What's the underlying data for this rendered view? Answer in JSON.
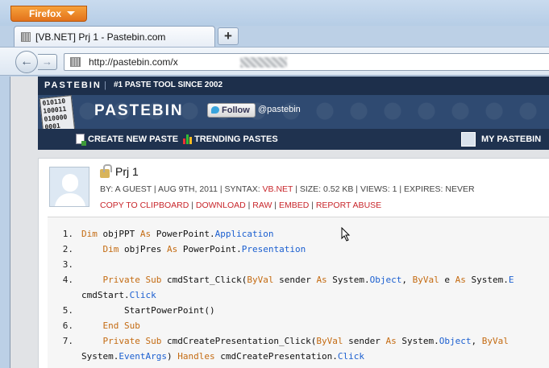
{
  "browser": {
    "menu_button": "Firefox",
    "tab_title": "[VB.NET] Prj 1 - Pastebin.com",
    "new_tab": "+",
    "url": "http://pastebin.com/x"
  },
  "site": {
    "brand": "PASTEBIN",
    "separator": "|",
    "tagline": "#1 PASTE TOOL SINCE 2002",
    "logo_text": "PASTEBIN",
    "logo_binary": [
      "010110",
      "100011",
      "010000",
      "0001"
    ],
    "follow_label": "Follow",
    "twitter_handle": "@pastebin",
    "nav": {
      "create": "CREATE NEW PASTE",
      "trending": "TRENDING PASTES",
      "my": "MY PASTEBIN"
    }
  },
  "paste": {
    "title": "Prj 1",
    "meta_prefix": "BY: A GUEST | AUG 9TH, 2011 | SYNTAX:",
    "syntax": "VB.NET",
    "meta_suffix": "| SIZE: 0.52 KB | VIEWS: 1 | EXPIRES: NEVER",
    "actions": [
      "COPY TO CLIPBOARD",
      "DOWNLOAD",
      "RAW",
      "EMBED",
      "REPORT ABUSE"
    ],
    "action_sep": " | "
  },
  "code": {
    "lines": [
      {
        "num": "1.",
        "text": "Dim objPPT As PowerPoint.Application"
      },
      {
        "num": "2.",
        "text": "    Dim objPres As PowerPoint.Presentation"
      },
      {
        "num": "3.",
        "text": ""
      },
      {
        "num": "4.",
        "text": "    Private Sub cmdStart_Click(ByVal sender As System.Object, ByVal e As System.E"
      },
      {
        "num": "",
        "text": "cmdStart.Click"
      },
      {
        "num": "5.",
        "text": "        StartPowerPoint()"
      },
      {
        "num": "6.",
        "text": "    End Sub"
      },
      {
        "num": "7.",
        "text": "    Private Sub cmdCreatePresentation_Click(ByVal sender As System.Object, ByVal"
      },
      {
        "num": "",
        "text": "System.EventArgs) Handles cmdCreatePresentation.Click"
      }
    ]
  },
  "colors": {
    "header_dark": "#1d2f4b",
    "header_mid": "#2f4a71",
    "link_red": "#c8262b",
    "keyword": "#c46b12",
    "type_blue": "#1b5fd0"
  }
}
